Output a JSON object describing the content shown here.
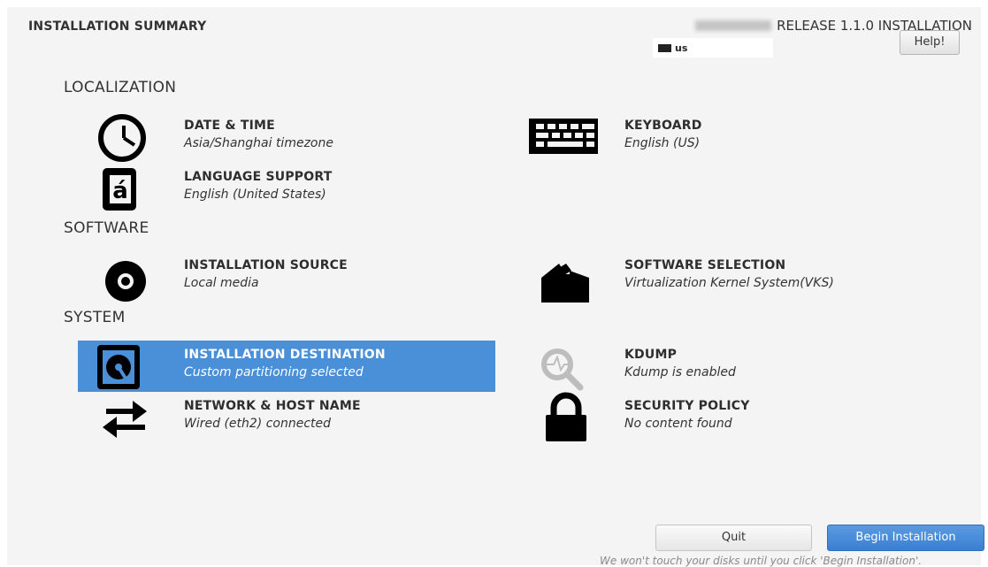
{
  "header": {
    "title": "INSTALLATION SUMMARY",
    "release": "RELEASE 1.1.0 INSTALLATION",
    "keyboard_indicator": "us",
    "help_label": "Help!"
  },
  "sections": {
    "localization": "LOCALIZATION",
    "software": "SOFTWARE",
    "system": "SYSTEM"
  },
  "spokes": {
    "date_time": {
      "label": "DATE & TIME",
      "status": "Asia/Shanghai timezone",
      "icon": "clock-icon"
    },
    "keyboard": {
      "label": "KEYBOARD",
      "status": "English (US)",
      "icon": "keyboard-icon"
    },
    "language_support": {
      "label": "LANGUAGE SUPPORT",
      "status": "English (United States)",
      "icon": "language-icon"
    },
    "installation_source": {
      "label": "INSTALLATION SOURCE",
      "status": "Local media",
      "icon": "disc-icon"
    },
    "software_selection": {
      "label": "SOFTWARE SELECTION",
      "status": "Virtualization Kernel System(VKS)",
      "icon": "package-icon"
    },
    "installation_destination": {
      "label": "INSTALLATION DESTINATION",
      "status": "Custom partitioning selected",
      "icon": "harddisk-icon",
      "selected": true
    },
    "kdump": {
      "label": "KDUMP",
      "status": "Kdump is enabled",
      "icon": "magnifier-icon"
    },
    "network": {
      "label": "NETWORK & HOST NAME",
      "status": "Wired (eth2) connected",
      "icon": "network-arrows-icon"
    },
    "security_policy": {
      "label": "SECURITY POLICY",
      "status": "No content found",
      "icon": "lock-icon"
    }
  },
  "footer": {
    "quit_label": "Quit",
    "begin_label": "Begin Installation",
    "note": "We won't touch your disks until you click 'Begin Installation'."
  },
  "colors": {
    "selected_bg": "#4a90d9",
    "begin_button": "#3a7fd0",
    "background": "#f4f4f4"
  }
}
